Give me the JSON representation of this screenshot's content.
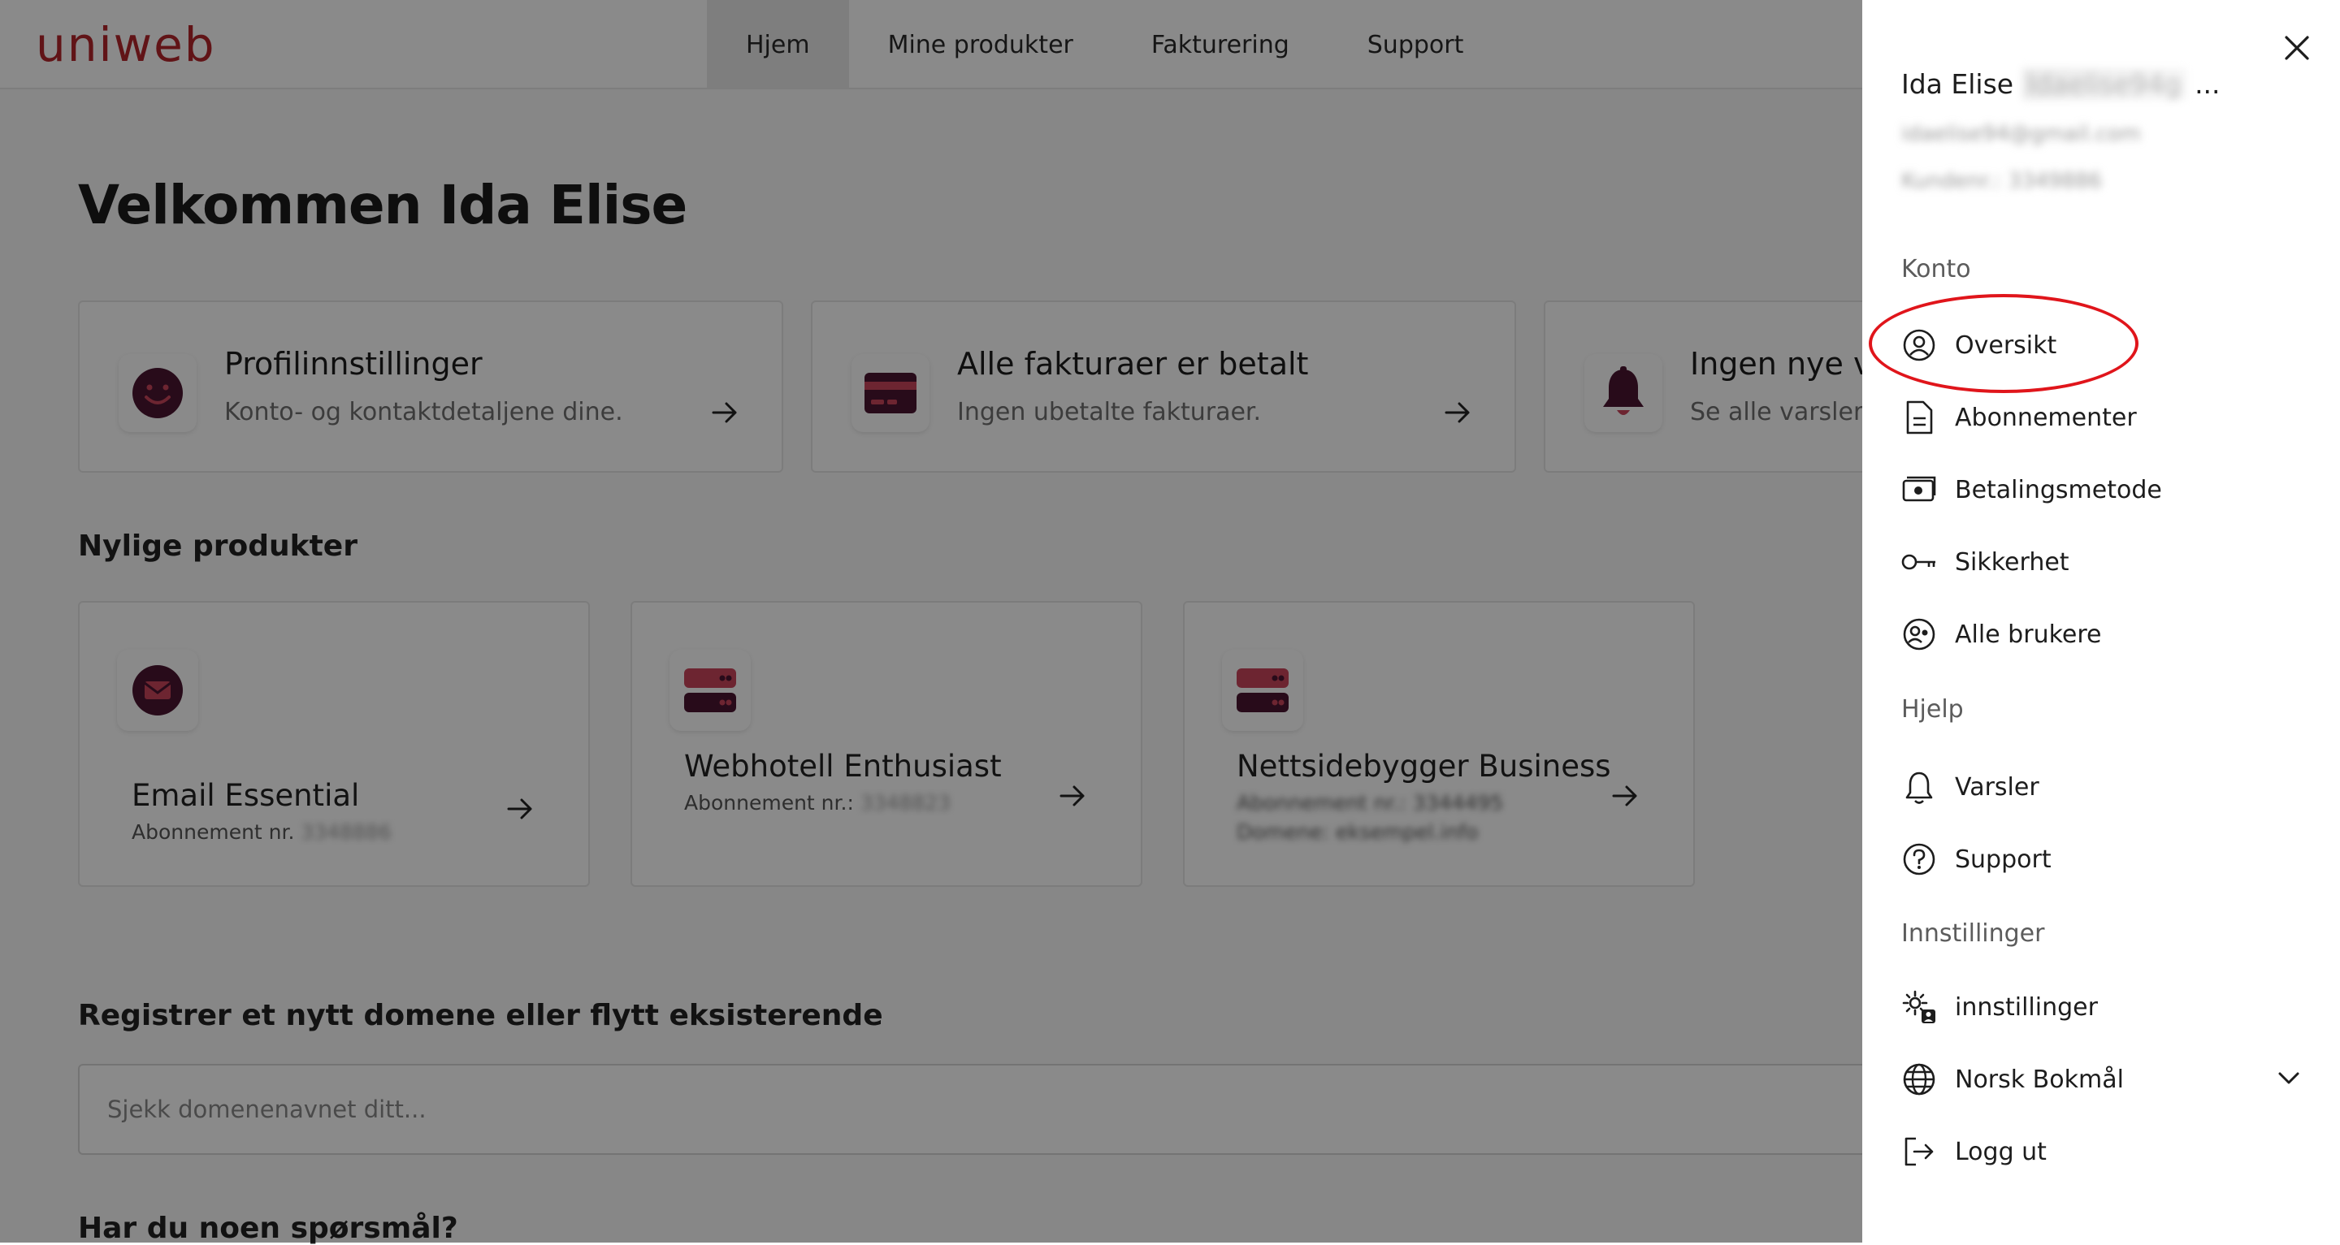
{
  "brand": {
    "logo_text": "uniweb",
    "color": "#b3262c"
  },
  "nav": {
    "items": [
      {
        "label": "Hjem",
        "active": true
      },
      {
        "label": "Mine produkter",
        "active": false
      },
      {
        "label": "Fakturering",
        "active": false
      },
      {
        "label": "Support",
        "active": false
      }
    ]
  },
  "welcome": "Velkommen Ida Elise",
  "cards": [
    {
      "title": "Profilinnstillinger",
      "subtitle": "Konto- og kontaktdetaljene dine.",
      "icon": "smile-icon"
    },
    {
      "title": "Alle fakturaer er betalt",
      "subtitle": "Ingen ubetalte fakturaer.",
      "icon": "credit-card-icon"
    },
    {
      "title": "Ingen nye va",
      "subtitle": "Se alle varsler.",
      "icon": "bell-icon"
    }
  ],
  "recent": {
    "heading": "Nylige produkter",
    "products": [
      {
        "name": "Email Essential",
        "meta_label": "Abonnement nr.",
        "meta_value": "3348886",
        "icon": "mail-icon"
      },
      {
        "name": "Webhotell Enthusiast",
        "meta_label": "Abonnement nr.:",
        "meta_value": "3348823",
        "icon": "server-icon"
      },
      {
        "name": "Nettsidebygger Business",
        "meta_label": "Abonnement nr.: 3344495",
        "meta_value": "Domene: eksempel.info",
        "icon": "server-icon"
      }
    ]
  },
  "domain": {
    "heading": "Registrer et nytt domene eller flytt eksisterende",
    "placeholder": "Sjekk domenenavnet ditt..."
  },
  "faq": {
    "heading": "Har du noen spørsmål?"
  },
  "drawer": {
    "user": {
      "first": "Ida Elise",
      "last": "Idaelise94g",
      "ellipsis": "...",
      "email": "idaelise94@gmail.com",
      "customer": "Kundenr.: 3349886"
    },
    "groups": {
      "account": "Konto",
      "help": "Hjelp",
      "settings": "Innstillinger"
    },
    "account_items": [
      {
        "label": "Oversikt",
        "icon": "user-circle-icon"
      },
      {
        "label": "Abonnementer",
        "icon": "document-icon"
      },
      {
        "label": "Betalingsmetode",
        "icon": "money-icon"
      },
      {
        "label": "Sikkerhet",
        "icon": "key-icon"
      },
      {
        "label": "Alle brukere",
        "icon": "users-icon"
      }
    ],
    "help_items": [
      {
        "label": "Varsler",
        "icon": "bell-icon"
      },
      {
        "label": "Support",
        "icon": "question-icon"
      }
    ],
    "settings_items": [
      {
        "label": "innstillinger",
        "icon": "settings-user-icon"
      },
      {
        "label": "Norsk Bokmål",
        "icon": "globe-icon"
      },
      {
        "label": "Logg ut",
        "icon": "logout-icon"
      }
    ],
    "highlight_color": "#e0151b"
  },
  "colors": {
    "accent": "#b3262c",
    "dark_accent": "#4a1530"
  }
}
